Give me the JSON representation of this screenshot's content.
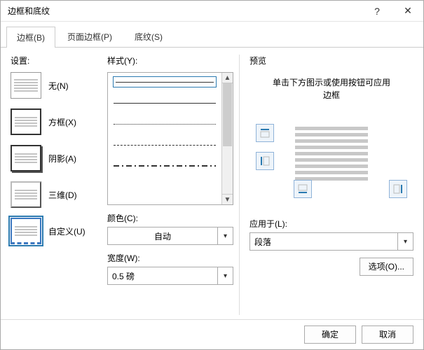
{
  "titlebar": {
    "title": "边框和底纹",
    "help": "?",
    "close": "✕"
  },
  "tabs": {
    "border": "边框(B)",
    "page": "页面边框(P)",
    "shading": "底纹(S)"
  },
  "settings": {
    "label": "设置:",
    "none": "无(N)",
    "box": "方框(X)",
    "shadow": "阴影(A)",
    "threed": "三维(D)",
    "custom": "自定义(U)"
  },
  "style": {
    "label": "样式(Y):",
    "color_label": "颜色(C):",
    "color_value": "自动",
    "width_label": "宽度(W):",
    "width_value": "0.5 磅"
  },
  "preview": {
    "label": "预览",
    "hint_line1": "单击下方图示或使用按钮可应用",
    "hint_line2": "边框",
    "apply_label": "应用于(L):",
    "apply_value": "段落",
    "options": "选项(O)..."
  },
  "footer": {
    "ok": "确定",
    "cancel": "取消"
  }
}
